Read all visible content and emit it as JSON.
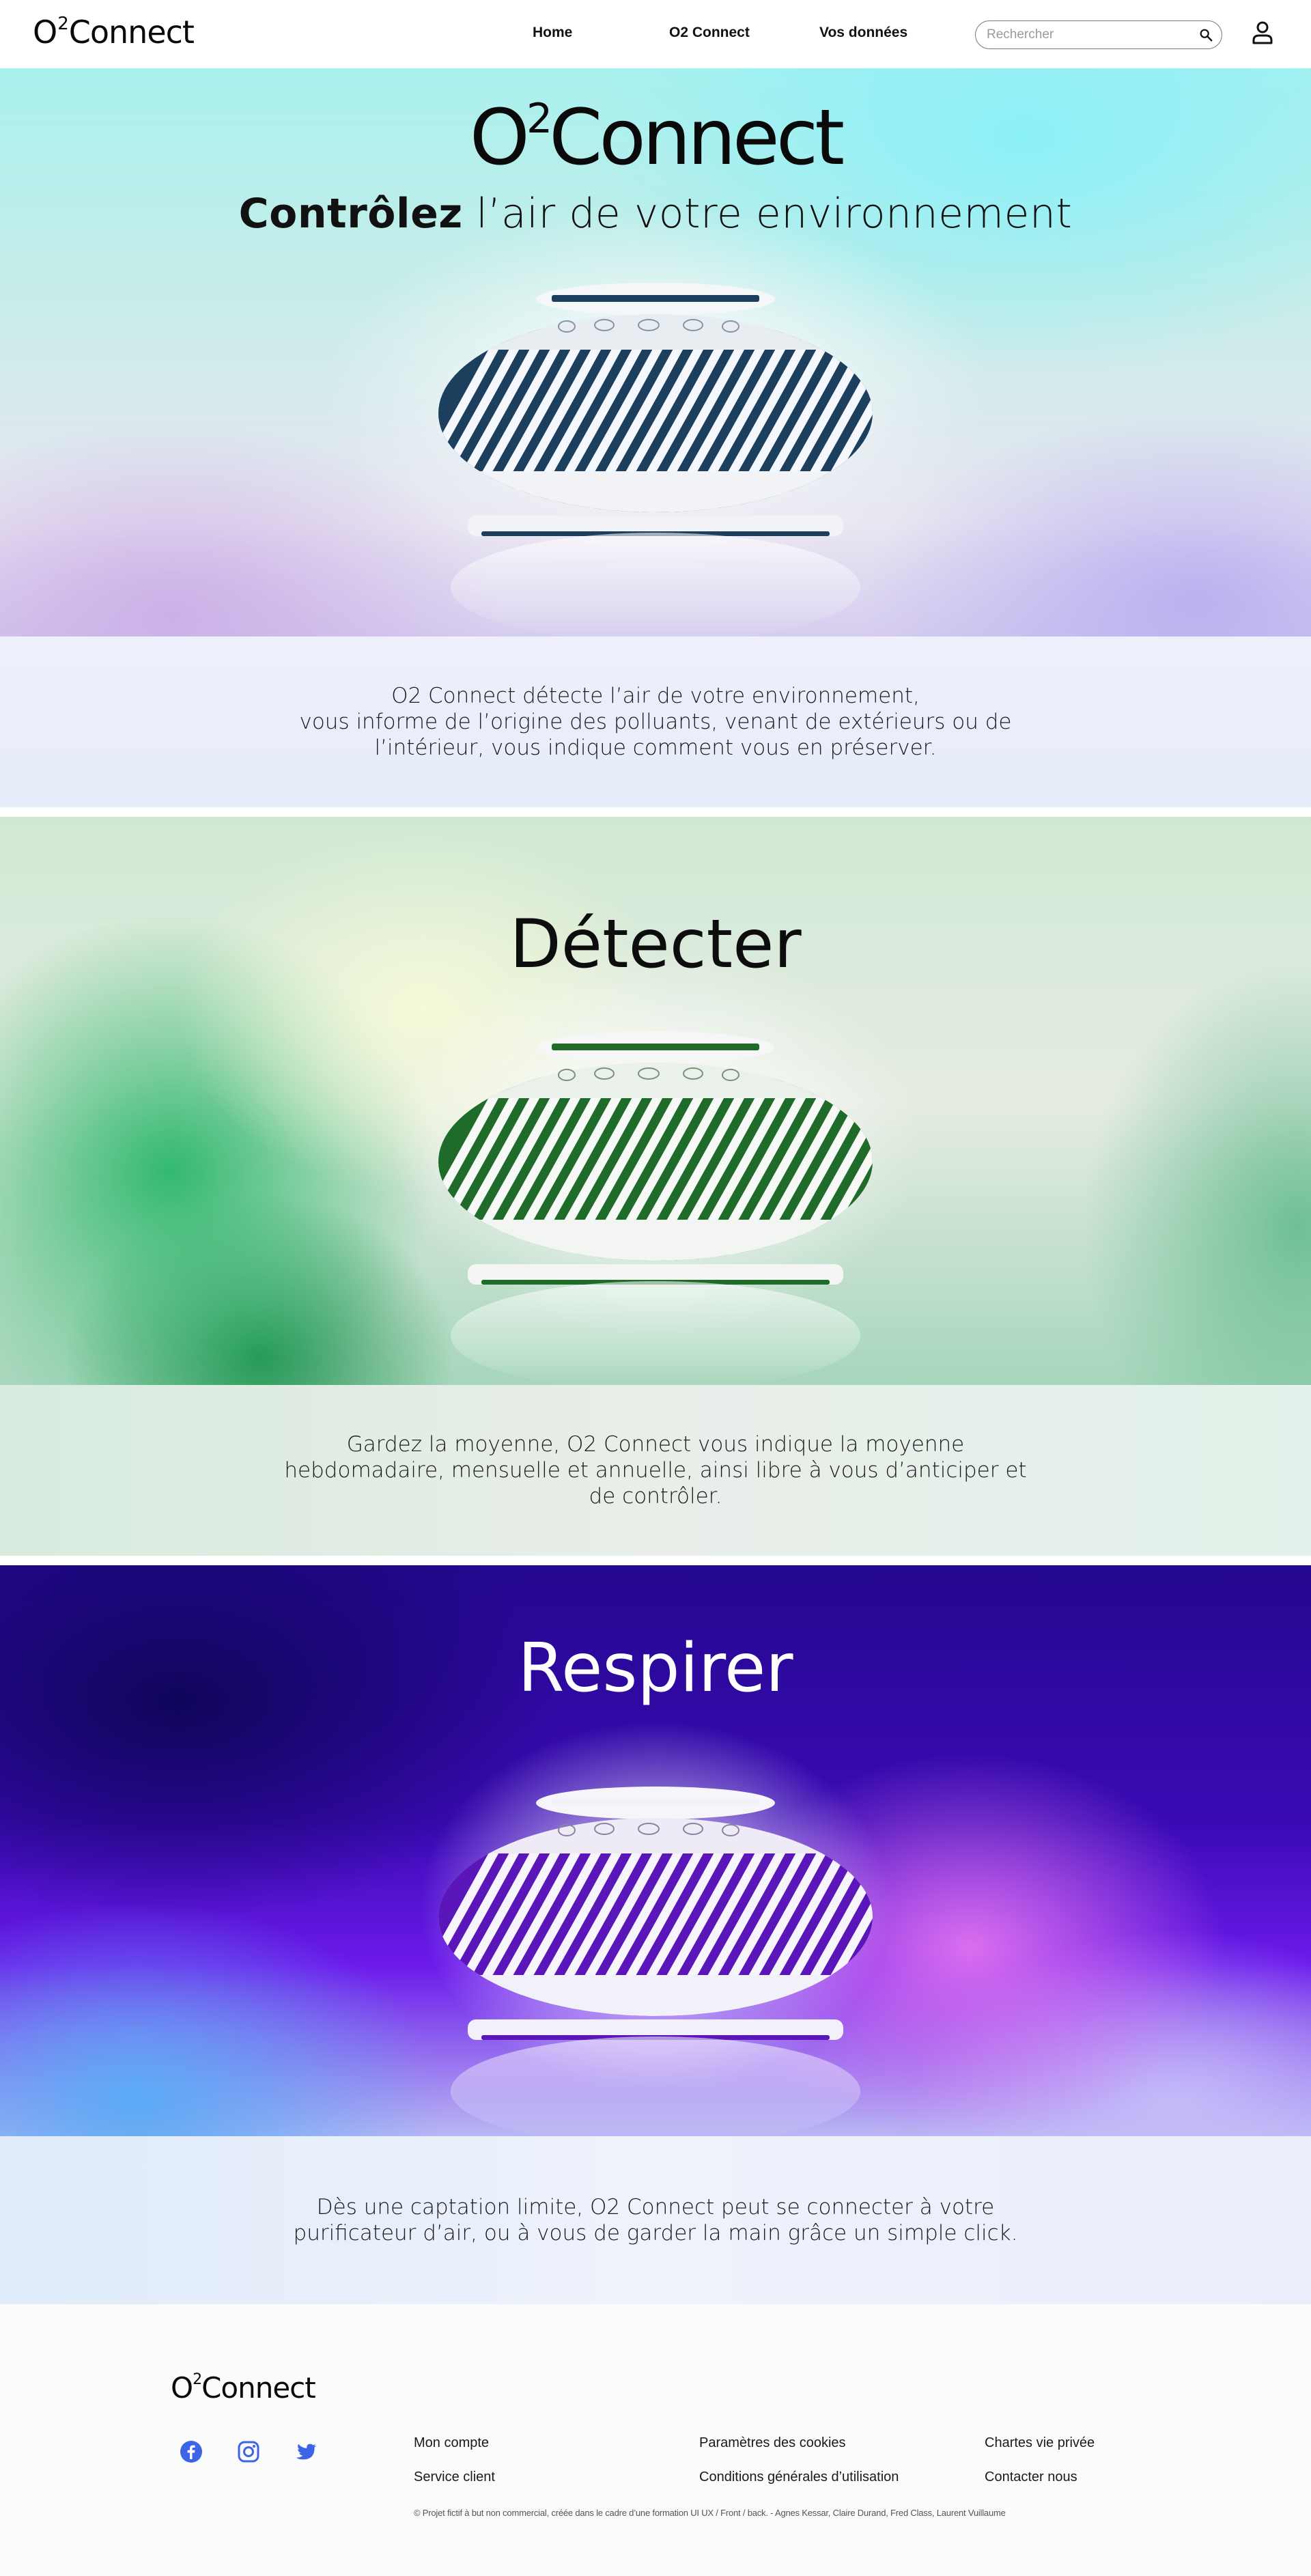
{
  "colors": {
    "accent_social": "#3d63e6",
    "green_device": "#1f6b2a",
    "purple_device": "#5a16b8",
    "blue_device": "#1d3f5e"
  },
  "header": {
    "logo": {
      "o": "O",
      "sup": "2",
      "rest": "Connect"
    },
    "nav": [
      "Home",
      "O2 Connect",
      "Vos données"
    ],
    "search_placeholder": "Rechercher",
    "search_icon": "search-icon",
    "user_icon": "user-icon"
  },
  "hero": {
    "logo": {
      "o": "O",
      "sup": "2",
      "rest": "Connect"
    },
    "tagline_bold": "Contrôlez",
    "tagline_rest": " l’air de votre environnement",
    "description": "O2 Connect détecte l’air de votre environnement,\nvous informe de l’origine des polluants, venant de extérieurs ou de\nl’intérieur, vous indique comment vous en préserver."
  },
  "detect": {
    "title": "Détecter",
    "description": "Gardez la moyenne, O2 Connect vous indique la moyenne\nhebdomadaire, mensuelle et annuelle, ainsi libre à vous d’anticiper et\nde contrôler."
  },
  "breathe": {
    "title": "Respirer",
    "description": "Dès une captation limite, O2 Connect peut se connecter à votre\npurificateur d’air, ou à vous de garder la main grâce un simple click."
  },
  "footer": {
    "logo": {
      "o": "O",
      "sup": "2",
      "rest": "Connect"
    },
    "social_icons": [
      "facebook-icon",
      "instagram-icon",
      "twitter-icon"
    ],
    "links": {
      "mon_compte": "Mon compte",
      "service_client": "Service client",
      "cookies": "Paramètres des cookies",
      "cgu": "Conditions générales d’utilisation",
      "vie_privee": "Chartes vie privée",
      "contact": "Contacter nous"
    },
    "copyright": "© Projet fictif à but non commercial, créée dans le cadre d’une formation  UI UX / Front / back. - Agnes Kessar, Claire Durand, Fred Class, Laurent Vuillaume"
  }
}
